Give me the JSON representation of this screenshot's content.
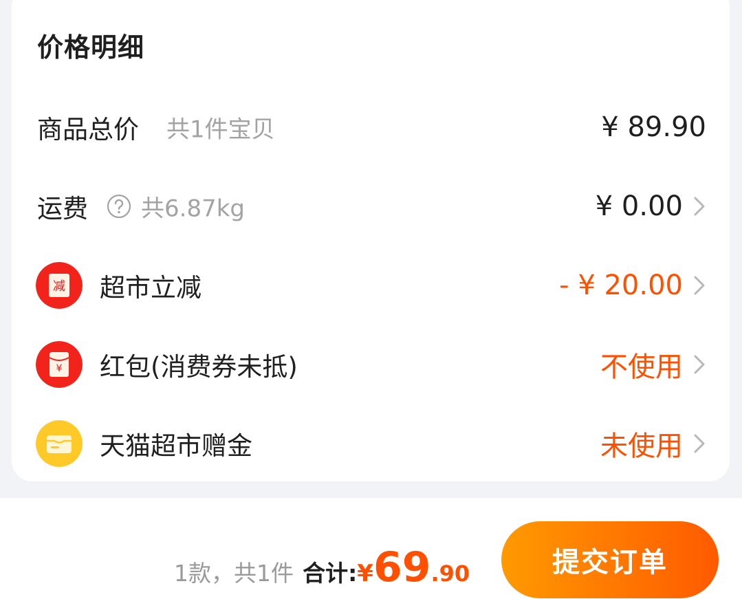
{
  "section": {
    "title": "价格明细"
  },
  "rows": {
    "goods": {
      "label": "商品总价",
      "sub": "共1件宝贝",
      "value": "¥ 89.90"
    },
    "shipping": {
      "label": "运费",
      "sub": "共6.87kg",
      "value": "¥ 0.00"
    },
    "discount": {
      "label": "超市立减",
      "value": "- ¥ 20.00",
      "badge_text": "减"
    },
    "redpacket": {
      "label": "红包(消费券未抵)",
      "value": "不使用",
      "badge_text": "¥"
    },
    "giftmoney": {
      "label": "天猫超市赠金",
      "value": "未使用"
    }
  },
  "footer": {
    "count_text": "1款，共1件",
    "total_label": "合计:",
    "currency": "¥",
    "total_int": "69",
    "total_dec": ".90",
    "submit_label": "提交订单"
  },
  "colors": {
    "accent": "#ff5000",
    "badge_red": "#f2231b",
    "badge_yellow": "#ffc928",
    "button_start": "#ff9a00",
    "button_end": "#ff5a00"
  }
}
